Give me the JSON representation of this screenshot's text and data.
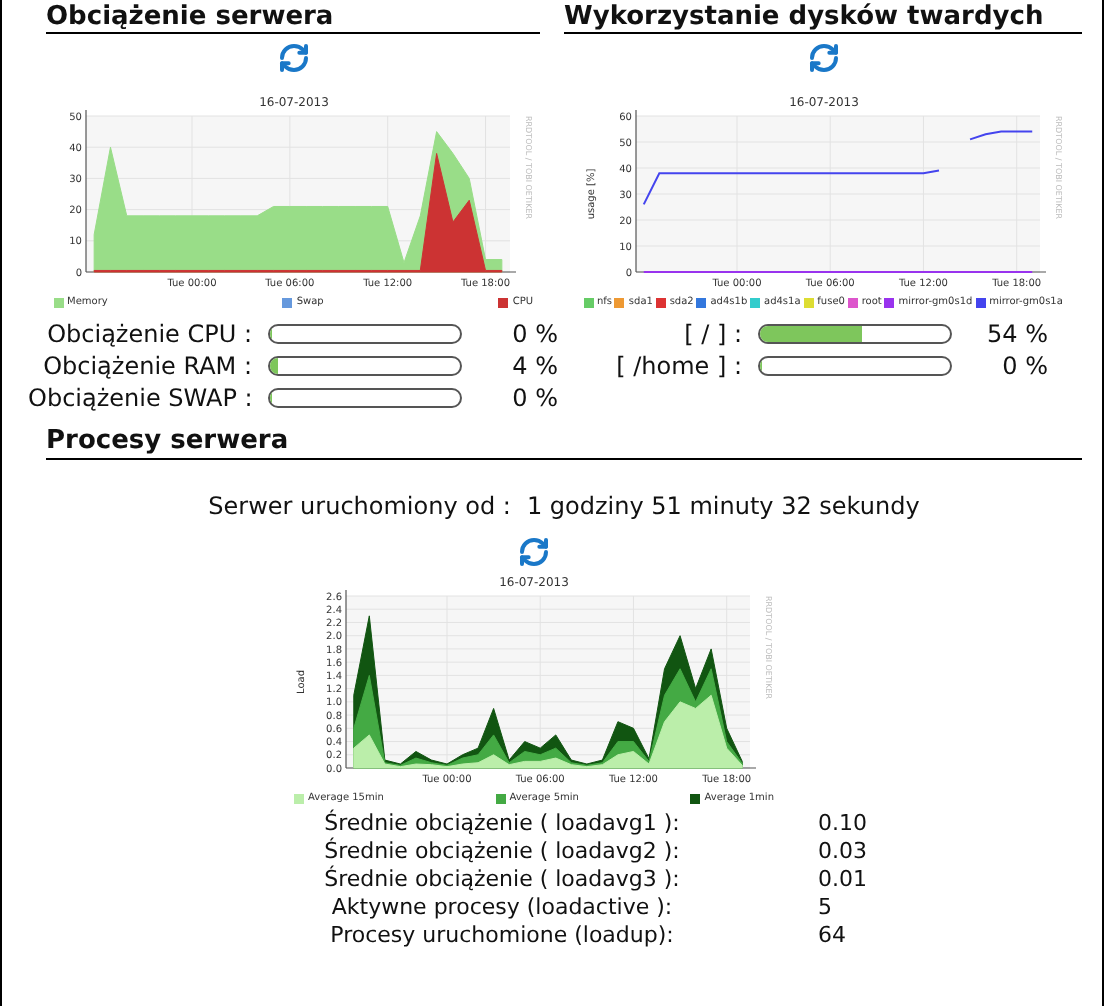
{
  "server_load": {
    "title": "Obciążenie serwera",
    "chart": {
      "credit": "RRDTOOL / TOBI OETIKER",
      "chart_data": {
        "type": "area",
        "title": "16-07-2013",
        "categories": [
          null,
          null,
          null,
          null,
          null,
          null,
          "Tue 00:00",
          null,
          null,
          null,
          null,
          null,
          "Tue 06:00",
          null,
          null,
          null,
          null,
          null,
          "Tue 12:00",
          null,
          null,
          null,
          null,
          null,
          "Tue 18:00",
          null
        ],
        "ylim": [
          0,
          50
        ],
        "yticks": [
          0,
          10,
          20,
          30,
          40,
          50
        ],
        "grid": true,
        "legend": "bottom",
        "series": [
          {
            "name": "Memory",
            "color": "#99dd88",
            "values": [
              12,
              40,
              18,
              18,
              18,
              18,
              18,
              18,
              18,
              18,
              18,
              21,
              21,
              21,
              21,
              21,
              21,
              21,
              21,
              3,
              18,
              45,
              38,
              30,
              4,
              4
            ]
          },
          {
            "name": "Swap",
            "color": "#6699dd",
            "values": [
              null,
              null,
              null,
              null,
              null,
              null,
              null,
              null,
              null,
              null,
              null,
              null,
              null,
              null,
              null,
              null,
              null,
              null,
              null,
              null,
              null,
              null,
              null,
              null,
              null,
              null
            ]
          },
          {
            "name": "CPU",
            "color": "#cc3333",
            "values": [
              0.5,
              0.5,
              0.5,
              0.5,
              0.5,
              0.5,
              0.5,
              0.5,
              0.5,
              0.5,
              0.5,
              0.5,
              0.5,
              0.5,
              0.5,
              0.5,
              0.5,
              0.5,
              0.5,
              0.5,
              0.5,
              38,
              16,
              23,
              0.5,
              0.5
            ]
          }
        ]
      }
    },
    "meters": [
      {
        "label": "Obciążenie CPU :",
        "level": 0,
        "reading": "0 %"
      },
      {
        "label": "Obciążenie RAM :",
        "level": 0.04,
        "reading": "4 %"
      },
      {
        "label": "Obciążenie SWAP :",
        "level": 0,
        "reading": "0 %"
      }
    ]
  },
  "disk_usage": {
    "title": "Wykorzystanie dysków twardych",
    "chart": {
      "credit": "RRDTOOL / TOBI OETIKER",
      "chart_data": {
        "type": "line",
        "title": "16-07-2013",
        "ylabel": "usage [%]",
        "categories": [
          null,
          null,
          null,
          null,
          null,
          null,
          "Tue 00:00",
          null,
          null,
          null,
          null,
          null,
          "Tue 06:00",
          null,
          null,
          null,
          null,
          null,
          "Tue 12:00",
          null,
          null,
          null,
          null,
          null,
          "Tue 18:00",
          null
        ],
        "ylim": [
          0,
          60
        ],
        "yticks": [
          0,
          10,
          20,
          30,
          40,
          50,
          60
        ],
        "grid": true,
        "legend": "bottom",
        "series": [
          {
            "name": "nfs",
            "color": "#66cc66",
            "values": [
              null,
              null,
              null,
              null,
              null,
              null,
              null,
              null,
              null,
              null,
              null,
              null,
              null,
              null,
              null,
              null,
              null,
              null,
              null,
              null,
              null,
              null,
              null,
              null,
              null,
              null
            ]
          },
          {
            "name": "sda1",
            "color": "#ee9933",
            "values": [
              null,
              null,
              null,
              null,
              null,
              null,
              null,
              null,
              null,
              null,
              null,
              null,
              null,
              null,
              null,
              null,
              null,
              null,
              null,
              null,
              null,
              null,
              null,
              null,
              null,
              null
            ]
          },
          {
            "name": "sda2",
            "color": "#dd3333",
            "values": [
              null,
              null,
              null,
              null,
              null,
              null,
              null,
              null,
              null,
              null,
              null,
              null,
              null,
              null,
              null,
              null,
              null,
              null,
              null,
              null,
              null,
              null,
              null,
              null,
              null,
              null
            ]
          },
          {
            "name": "ad4s1b",
            "color": "#3377dd",
            "values": [
              null,
              null,
              null,
              null,
              null,
              null,
              null,
              null,
              null,
              null,
              null,
              null,
              null,
              null,
              null,
              null,
              null,
              null,
              null,
              null,
              null,
              null,
              null,
              null,
              null,
              null
            ]
          },
          {
            "name": "ad4s1a",
            "color": "#33cccc",
            "values": [
              null,
              null,
              null,
              null,
              null,
              null,
              null,
              null,
              null,
              null,
              null,
              null,
              null,
              null,
              null,
              null,
              null,
              null,
              null,
              null,
              null,
              null,
              null,
              null,
              null,
              null
            ]
          },
          {
            "name": "fuse0",
            "color": "#dddd33",
            "values": [
              null,
              null,
              null,
              null,
              null,
              null,
              null,
              null,
              null,
              null,
              null,
              null,
              null,
              null,
              null,
              null,
              null,
              null,
              null,
              null,
              null,
              null,
              null,
              null,
              null,
              null
            ]
          },
          {
            "name": "root",
            "color": "#dd55cc",
            "values": [
              null,
              null,
              null,
              null,
              null,
              null,
              null,
              null,
              null,
              null,
              null,
              null,
              null,
              null,
              null,
              null,
              null,
              null,
              null,
              null,
              null,
              null,
              null,
              null,
              null,
              null
            ]
          },
          {
            "name": "mirror-gm0s1d",
            "color": "#9933ee",
            "values": [
              0,
              0,
              0,
              0,
              0,
              0,
              0,
              0,
              0,
              0,
              0,
              0,
              0,
              0,
              0,
              0,
              0,
              0,
              0,
              0,
              0,
              0,
              0,
              0,
              0,
              0
            ]
          },
          {
            "name": "mirror-gm0s1a",
            "color": "#4444ee",
            "values": [
              26,
              38,
              38,
              38,
              38,
              38,
              38,
              38,
              38,
              38,
              38,
              38,
              38,
              38,
              38,
              38,
              38,
              38,
              38,
              39,
              null,
              51,
              53,
              54,
              54,
              54
            ]
          }
        ]
      }
    },
    "meters": [
      {
        "label": "[ / ] :",
        "level": 0.54,
        "reading": "54 %"
      },
      {
        "label": "[ /home ] :",
        "level": 0,
        "reading": "0 %"
      }
    ]
  },
  "processes": {
    "title": "Procesy serwera",
    "uptime_label": "Serwer uruchomiony od :",
    "uptime_value": "1 godziny 51 minuty 32 sekundy",
    "chart": {
      "credit": "RRDTOOL / TOBI OETIKER",
      "chart_data": {
        "type": "area",
        "title": "16-07-2013",
        "ylabel": "Load",
        "categories": [
          null,
          null,
          null,
          null,
          null,
          null,
          "Tue 00:00",
          null,
          null,
          null,
          null,
          null,
          "Tue 06:00",
          null,
          null,
          null,
          null,
          null,
          "Tue 12:00",
          null,
          null,
          null,
          null,
          null,
          "Tue 18:00",
          null
        ],
        "ylim": [
          0,
          2.6
        ],
        "grid": true,
        "legend": "bottom",
        "yticks": [
          {
            "value": 0,
            "label": "0.0"
          },
          {
            "value": 0.2,
            "label": "0.2"
          },
          {
            "value": 0.4,
            "label": "0.4"
          },
          {
            "value": 0.6,
            "label": "0.6"
          },
          {
            "value": 0.8,
            "label": "0.8"
          },
          {
            "value": 1,
            "label": "1.0"
          },
          {
            "value": 1.2,
            "label": "1.2"
          },
          {
            "value": 1.4,
            "label": "1.4"
          },
          {
            "value": 1.6,
            "label": "1.6"
          },
          {
            "value": 1.8,
            "label": "1.8"
          },
          {
            "value": 2,
            "label": "2.0"
          },
          {
            "value": 2.2,
            "label": "2.2"
          },
          {
            "value": 2.4,
            "label": "2.4"
          },
          {
            "value": 2.6,
            "label": "2.6"
          }
        ],
        "series": [
          {
            "name": "Average 15min",
            "color": "#bbeeaa",
            "values": [
              0.3,
              0.5,
              0.06,
              0.02,
              0.06,
              0.05,
              0.02,
              0.06,
              0.08,
              0.2,
              0.05,
              0.1,
              0.1,
              0.15,
              0.05,
              0.02,
              0.05,
              0.2,
              0.25,
              0.06,
              0.7,
              1.0,
              0.9,
              1.1,
              0.3,
              0.04
            ]
          },
          {
            "name": "Average 5min",
            "color": "#44aa44",
            "values": [
              0.6,
              1.4,
              0.08,
              0.04,
              0.15,
              0.08,
              0.04,
              0.15,
              0.2,
              0.5,
              0.08,
              0.25,
              0.2,
              0.3,
              0.08,
              0.04,
              0.08,
              0.4,
              0.4,
              0.1,
              1.1,
              1.5,
              1.0,
              1.5,
              0.4,
              0.07
            ]
          },
          {
            "name": "Average 1min",
            "color": "#115511",
            "values": [
              1.1,
              2.3,
              0.12,
              0.06,
              0.25,
              0.12,
              0.06,
              0.2,
              0.3,
              0.9,
              0.12,
              0.4,
              0.3,
              0.5,
              0.12,
              0.06,
              0.12,
              0.7,
              0.6,
              0.14,
              1.5,
              2.0,
              1.2,
              1.8,
              0.6,
              0.1
            ]
          }
        ]
      }
    },
    "stats": [
      {
        "label": "Średnie obciążenie ( loadavg1 ):",
        "value": "0.10"
      },
      {
        "label": "Średnie obciążenie ( loadavg2 ):",
        "value": "0.03"
      },
      {
        "label": "Średnie obciążenie ( loadavg3 ):",
        "value": "0.01"
      },
      {
        "label": "Aktywne procesy (loadactive ):",
        "value": "5"
      },
      {
        "label": "Procesy uruchomione (loadup):",
        "value": "64"
      }
    ]
  }
}
